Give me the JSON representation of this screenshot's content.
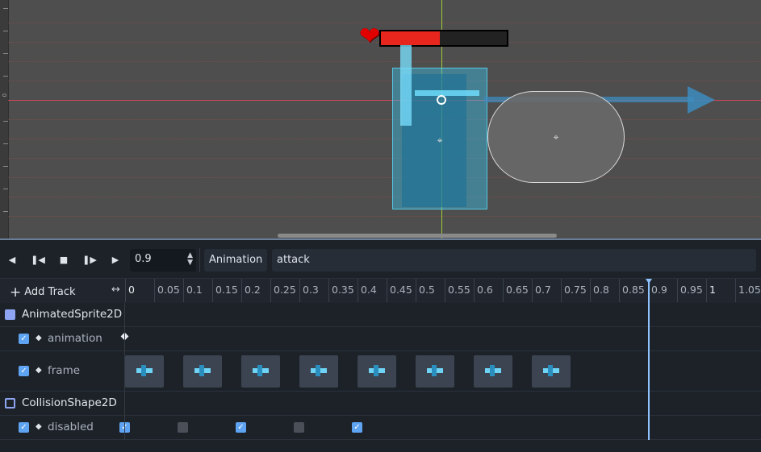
{
  "viewport": {
    "ruler_label": "0",
    "health_fill_fraction": 0.47
  },
  "toolbar": {
    "time_value": "0.9",
    "animation_label": "Animation",
    "animation_name": "attack"
  },
  "timeline": {
    "add_track_label": "Add Track",
    "ruler": [
      "0",
      "0.05",
      "0.1",
      "0.15",
      "0.2",
      "0.25",
      "0.3",
      "0.35",
      "0.4",
      "0.45",
      "0.5",
      "0.55",
      "0.6",
      "0.65",
      "0.7",
      "0.75",
      "0.8",
      "0.85",
      "0.9",
      "0.95",
      "1",
      "1.05"
    ]
  },
  "tracks": {
    "sprite_group": "AnimatedSprite2D",
    "animation_track": "animation",
    "frame_track": "frame",
    "collision_group": "CollisionShape2D",
    "disabled_track": "disabled",
    "disabled_keys": [
      true,
      false,
      true,
      false,
      true
    ]
  },
  "colors": {
    "accent": "#5ea4f2",
    "playhead": "#8ec3ff",
    "health": "#e8261d"
  }
}
